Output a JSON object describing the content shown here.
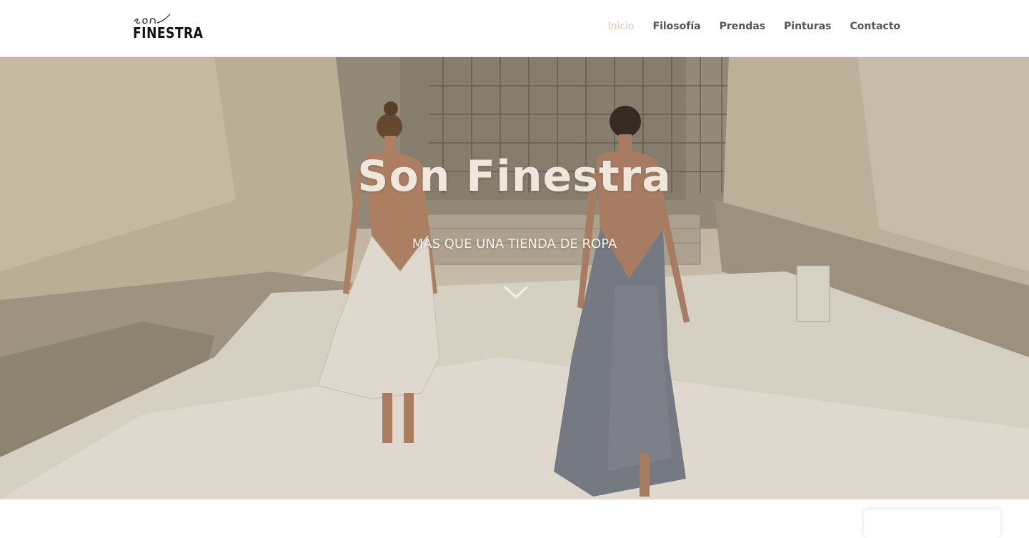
{
  "header": {
    "logo": {
      "script_text": "son",
      "word_text": "FINESTRA"
    },
    "nav": {
      "items": [
        {
          "label": "Inicio",
          "active": true
        },
        {
          "label": "Filosofía",
          "active": false
        },
        {
          "label": "Prendas",
          "active": false
        },
        {
          "label": "Pinturas",
          "active": false
        },
        {
          "label": "Contacto",
          "active": false
        }
      ]
    }
  },
  "hero": {
    "title": "Son Finestra",
    "subtitle": "MÁS QUE UNA TIENDA DE ROPA",
    "scroll_icon": "chevron-down-icon",
    "background_image": "two-women-in-backless-dresses-walking-in-stone-quarry"
  },
  "colors": {
    "nav_active": "#d9c7b8",
    "nav_text": "#555555",
    "hero_title": "#efe7dc"
  }
}
